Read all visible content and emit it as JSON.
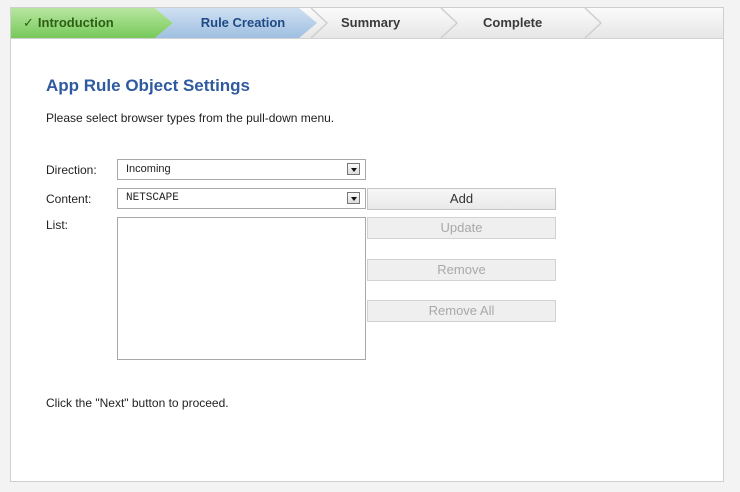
{
  "wizard": {
    "steps": [
      {
        "label": "Introduction",
        "state": "done",
        "check_icon": "✓"
      },
      {
        "label": "Rule Creation",
        "state": "current"
      },
      {
        "label": "Summary",
        "state": "upcoming"
      },
      {
        "label": "Complete",
        "state": "upcoming"
      }
    ]
  },
  "form": {
    "title": "App Rule Object Settings",
    "instruction": "Please select browser types from the pull-down menu.",
    "direction_label": "Direction:",
    "direction_value": "Incoming",
    "content_label": "Content:",
    "content_value": "NETSCAPE",
    "list_label": "List:",
    "buttons": {
      "add": "Add",
      "update": "Update",
      "remove": "Remove",
      "remove_all": "Remove All"
    },
    "footer": "Click the \"Next\" button to proceed."
  },
  "colors": {
    "title": "#2f5aa0",
    "step_done": "#76c95a",
    "step_current": "#9fbfe1"
  }
}
